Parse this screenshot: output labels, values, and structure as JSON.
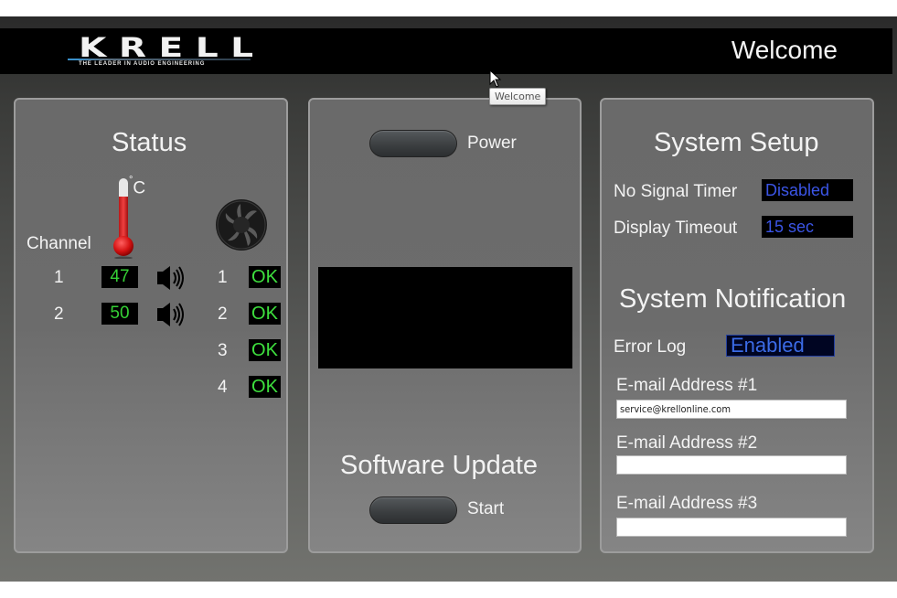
{
  "header": {
    "brand": "KRELL",
    "tagline": "THE LEADER IN AUDIO ENGINEERING",
    "title": "Welcome"
  },
  "tooltip": {
    "text": "Welcome"
  },
  "status": {
    "title": "Status",
    "channel_label": "Channel",
    "temp_unit": "C",
    "temp_unit_degree": "°",
    "channels": [
      {
        "number": "1",
        "temperature": "47"
      },
      {
        "number": "2",
        "temperature": "50"
      }
    ],
    "fans": [
      {
        "number": "1",
        "state": "OK"
      },
      {
        "number": "2",
        "state": "OK"
      },
      {
        "number": "3",
        "state": "OK"
      },
      {
        "number": "4",
        "state": "OK"
      }
    ],
    "colors": {
      "temp_text": "#35d035",
      "ok_text": "#3ee03e"
    }
  },
  "center": {
    "power_label": "Power",
    "software_update_title": "Software Update",
    "start_label": "Start"
  },
  "system_setup": {
    "title": "System Setup",
    "no_signal_timer_label": "No Signal Timer",
    "no_signal_timer_value": "Disabled",
    "display_timeout_label": "Display Timeout",
    "display_timeout_value": "15 sec"
  },
  "system_notification": {
    "title": "System Notification",
    "error_log_label": "Error Log",
    "error_log_value": "Enabled",
    "emails": [
      {
        "label": "E-mail Address #1",
        "value": "service@krellonline.com"
      },
      {
        "label": "E-mail Address #2",
        "value": ""
      },
      {
        "label": "E-mail Address #3",
        "value": ""
      }
    ],
    "colors": {
      "value_text": "#3b55e6"
    }
  }
}
